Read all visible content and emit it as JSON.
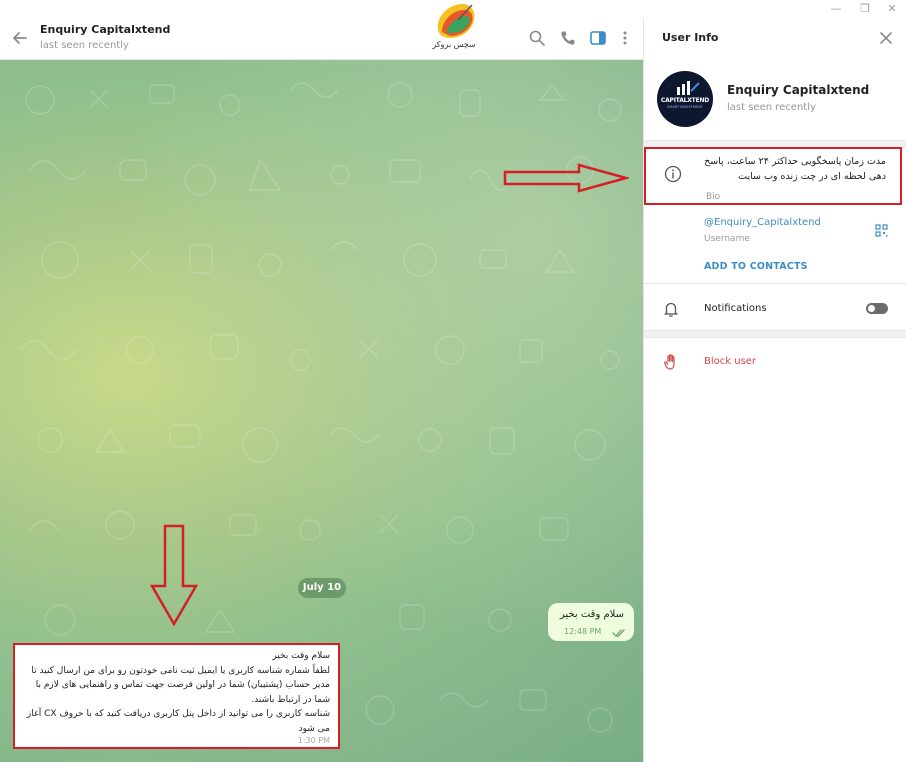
{
  "window": {
    "min_glyph": "—",
    "restore_glyph": "❐",
    "close_glyph": "✕"
  },
  "chat": {
    "title": "Enquiry Capitalxtend",
    "status": "last seen recently",
    "logo_text": "سچس بروکر",
    "date_label": "July 10",
    "outgoing": {
      "text": "سلام وقت بخیر",
      "time": "12:48 PM"
    },
    "incoming": {
      "text": "سلام وقت بخیر\nلطفاً شماره شناسه کاربری  یا ایمیل ثبت نامی خودتون رو برای من ارسال کنید تا مدیر حساب (پشتیبان) شما در اولین فرصت جهت تماس و راهنمایی های لازم با شما در ارتباط باشند.\nشناسه کاربری را می توانید از داخل پنل کاربری دریافت کنید که با حروف CX آغاز می شود",
      "time": "1:30 PM"
    }
  },
  "panel": {
    "title": "User Info",
    "avatar_text": "CAPITALXTEND",
    "avatar_sub": "SMART INVESTMENT",
    "name": "Enquiry Capitalxtend",
    "status": "last seen recently",
    "bio": "مدت زمان پاسخگویی حداکثر ۲۴ ساعت، پاسخ دهی لحظه ای در چت زنده وب سایت",
    "bio_label": "Bio",
    "username": "@Enquiry_Capitalxtend",
    "username_label": "Username",
    "add_contacts": "ADD TO CONTACTS",
    "notifications_label": "Notifications",
    "block_label": "Block user"
  },
  "colors": {
    "accent": "#3d8ec6",
    "highlight_red": "#d51f26",
    "danger": "#d14a4a",
    "bubble_out": "#effdde"
  },
  "icons": [
    "back-arrow-icon",
    "search-icon",
    "phone-icon",
    "sidebar-toggle-icon",
    "more-vertical-icon",
    "close-icon",
    "info-icon",
    "qr-code-icon",
    "bell-icon",
    "hand-block-icon",
    "double-check-icon"
  ]
}
